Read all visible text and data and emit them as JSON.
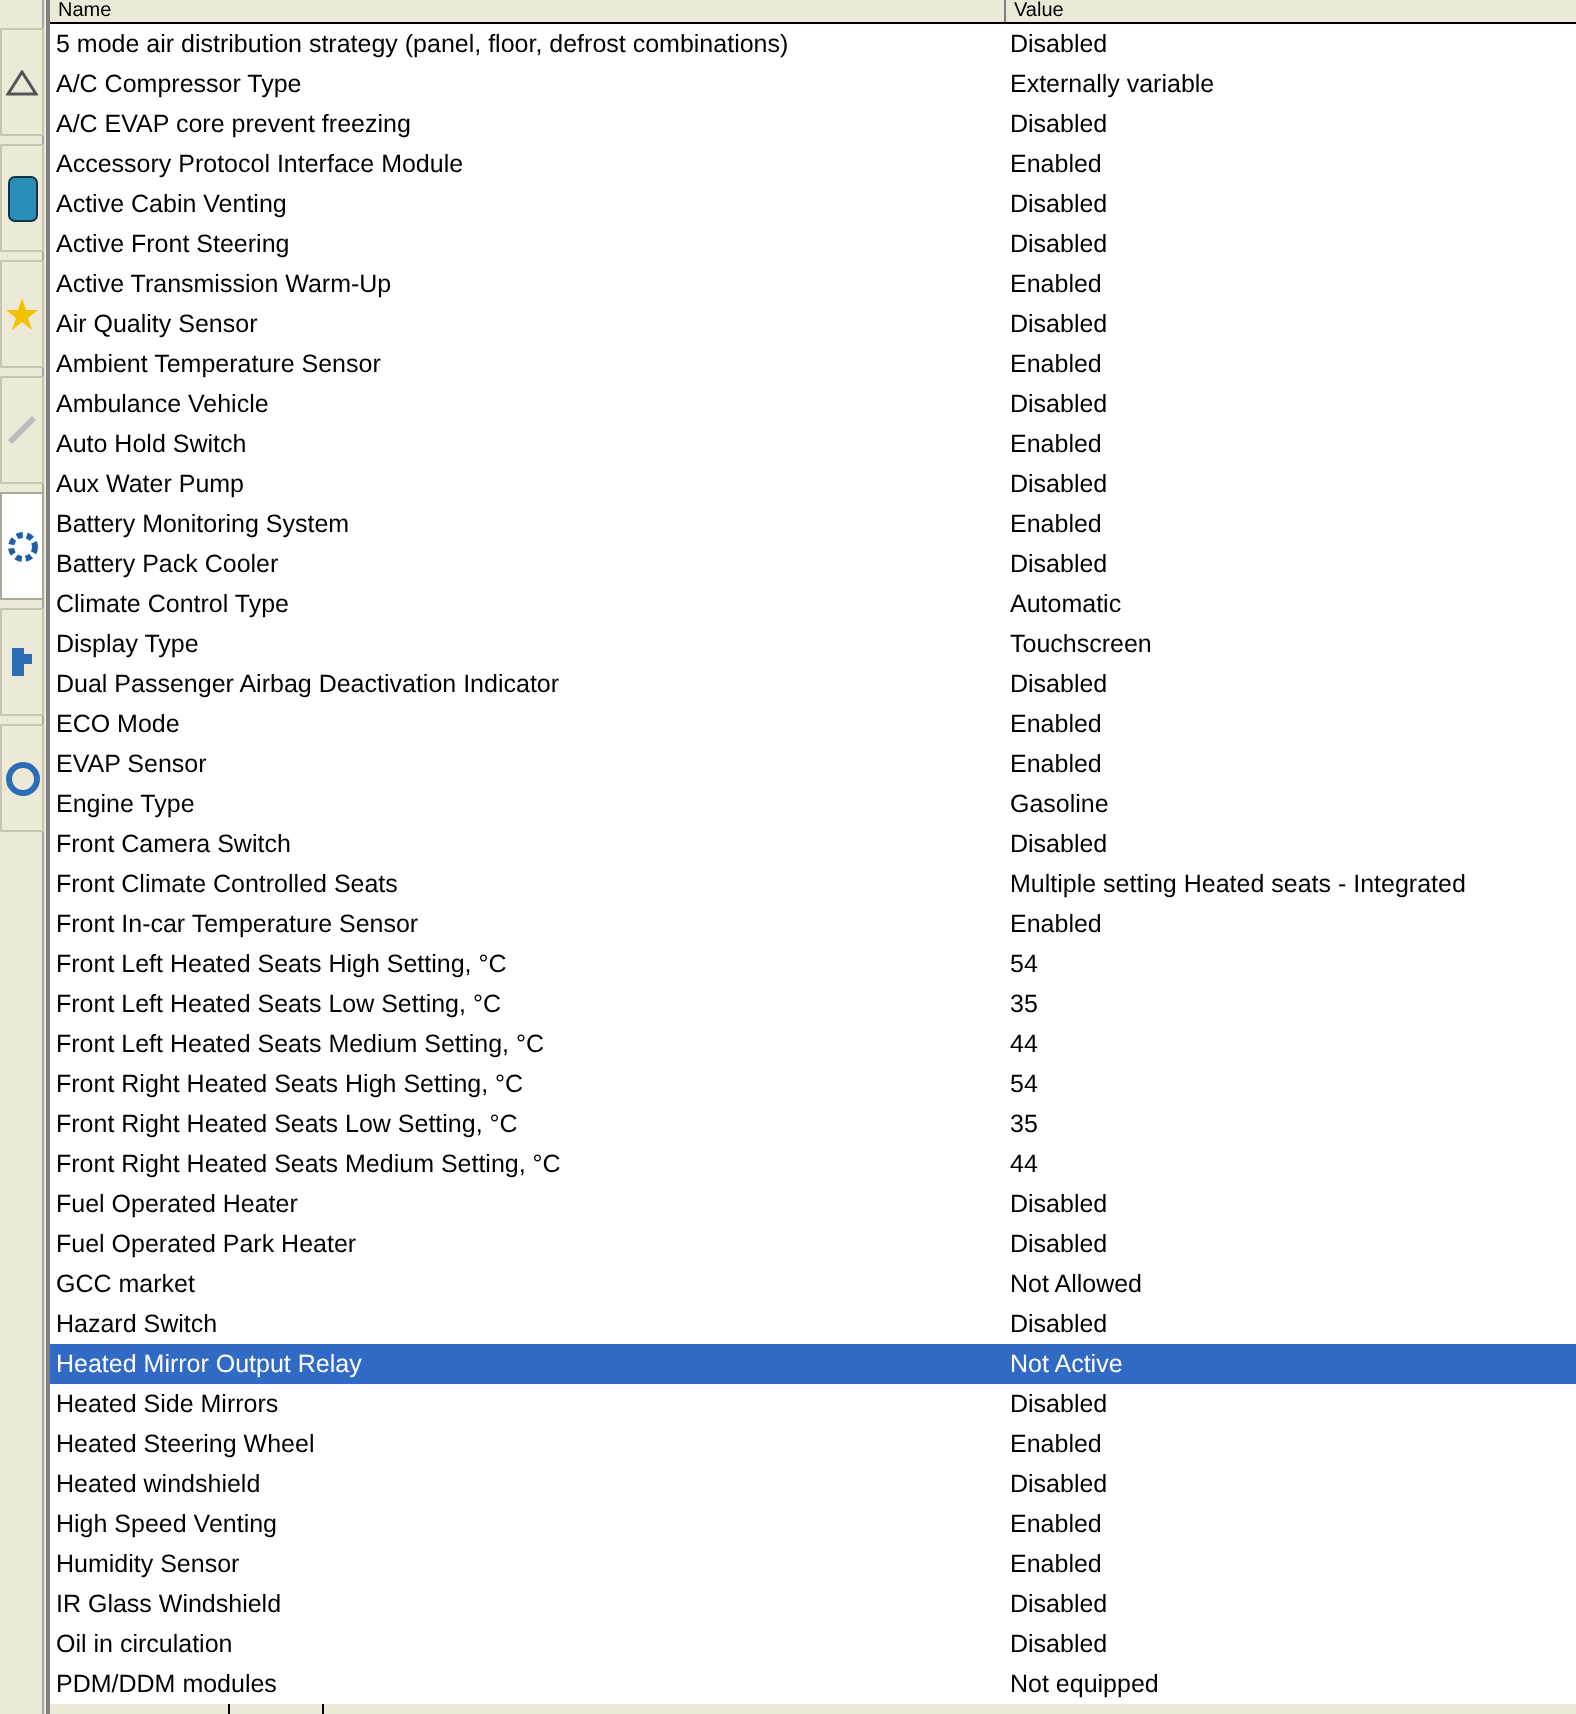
{
  "toolbar": {
    "buttons": [
      {
        "selected": false
      },
      {
        "selected": false
      },
      {
        "selected": false
      },
      {
        "selected": false
      },
      {
        "selected": true
      },
      {
        "selected": false
      },
      {
        "selected": false
      }
    ]
  },
  "table": {
    "columns": [
      "Name",
      "Value"
    ],
    "rows": [
      {
        "name": "5 mode air distribution strategy (panel, floor, defrost combinations)",
        "value": "Disabled",
        "selected": false
      },
      {
        "name": "A/C Compressor Type",
        "value": "Externally variable",
        "selected": false
      },
      {
        "name": "A/C EVAP core prevent freezing",
        "value": "Disabled",
        "selected": false
      },
      {
        "name": "Accessory Protocol Interface Module",
        "value": "Enabled",
        "selected": false
      },
      {
        "name": "Active Cabin Venting",
        "value": "Disabled",
        "selected": false
      },
      {
        "name": "Active Front Steering",
        "value": "Disabled",
        "selected": false
      },
      {
        "name": "Active Transmission Warm-Up",
        "value": "Enabled",
        "selected": false
      },
      {
        "name": "Air Quality Sensor",
        "value": "Disabled",
        "selected": false
      },
      {
        "name": "Ambient Temperature Sensor",
        "value": "Enabled",
        "selected": false
      },
      {
        "name": "Ambulance Vehicle",
        "value": "Disabled",
        "selected": false
      },
      {
        "name": "Auto Hold Switch",
        "value": "Enabled",
        "selected": false
      },
      {
        "name": "Aux Water Pump",
        "value": "Disabled",
        "selected": false
      },
      {
        "name": "Battery Monitoring System",
        "value": "Enabled",
        "selected": false
      },
      {
        "name": "Battery Pack Cooler",
        "value": "Disabled",
        "selected": false
      },
      {
        "name": "Climate Control Type",
        "value": "Automatic",
        "selected": false
      },
      {
        "name": "Display Type",
        "value": "Touchscreen",
        "selected": false
      },
      {
        "name": "Dual Passenger Airbag Deactivation Indicator",
        "value": "Disabled",
        "selected": false
      },
      {
        "name": "ECO Mode",
        "value": "Enabled",
        "selected": false
      },
      {
        "name": "EVAP Sensor",
        "value": "Enabled",
        "selected": false
      },
      {
        "name": "Engine Type",
        "value": "Gasoline",
        "selected": false
      },
      {
        "name": "Front Camera Switch",
        "value": "Disabled",
        "selected": false
      },
      {
        "name": "Front Climate Controlled Seats",
        "value": "Multiple setting Heated seats - Integrated",
        "selected": false
      },
      {
        "name": "Front In-car Temperature Sensor",
        "value": "Enabled",
        "selected": false
      },
      {
        "name": "Front Left Heated Seats High Setting, °C",
        "value": "54",
        "selected": false
      },
      {
        "name": "Front Left Heated Seats Low Setting, °C",
        "value": "35",
        "selected": false
      },
      {
        "name": "Front Left Heated Seats Medium Setting, °C",
        "value": "44",
        "selected": false
      },
      {
        "name": "Front Right Heated Seats High Setting, °C",
        "value": "54",
        "selected": false
      },
      {
        "name": "Front Right Heated Seats Low Setting, °C",
        "value": "35",
        "selected": false
      },
      {
        "name": "Front Right Heated Seats Medium Setting, °C",
        "value": "44",
        "selected": false
      },
      {
        "name": "Fuel Operated Heater",
        "value": "Disabled",
        "selected": false
      },
      {
        "name": "Fuel Operated Park Heater",
        "value": "Disabled",
        "selected": false
      },
      {
        "name": "GCC market",
        "value": "Not Allowed",
        "selected": false
      },
      {
        "name": "Hazard Switch",
        "value": "Disabled",
        "selected": false
      },
      {
        "name": "Heated Mirror Output Relay",
        "value": "Not Active",
        "selected": true
      },
      {
        "name": "Heated Side Mirrors",
        "value": "Disabled",
        "selected": false
      },
      {
        "name": "Heated Steering Wheel",
        "value": "Enabled",
        "selected": false
      },
      {
        "name": "Heated windshield",
        "value": "Disabled",
        "selected": false
      },
      {
        "name": "High Speed Venting",
        "value": "Enabled",
        "selected": false
      },
      {
        "name": "Humidity Sensor",
        "value": "Enabled",
        "selected": false
      },
      {
        "name": "IR Glass Windshield",
        "value": "Disabled",
        "selected": false
      },
      {
        "name": "Oil in circulation",
        "value": "Disabled",
        "selected": false
      },
      {
        "name": "PDM/DDM modules",
        "value": "Not equipped",
        "selected": false
      }
    ]
  }
}
